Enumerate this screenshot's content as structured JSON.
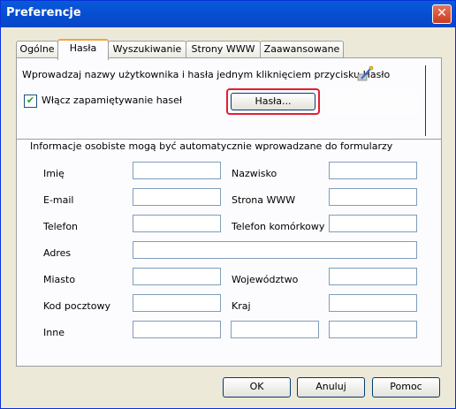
{
  "window": {
    "title": "Preferencje"
  },
  "tabs": [
    {
      "label": "Ogólne"
    },
    {
      "label": "Hasła"
    },
    {
      "label": "Wyszukiwanie"
    },
    {
      "label": "Strony WWW"
    },
    {
      "label": "Zaawansowane"
    }
  ],
  "passwords": {
    "info": "Wprowadzaj nazwy użytkownika i hasła jednym kliknięciem przycisku Hasło",
    "checkbox_label": "Włącz zapamiętywanie haseł",
    "checkbox_checked": true,
    "button_label": "Hasła..."
  },
  "personal": {
    "info": "Informacje osobiste mogą być automatycznie wprowadzane do formularzy",
    "fields": {
      "first_name": {
        "label": "Imię",
        "value": ""
      },
      "last_name": {
        "label": "Nazwisko",
        "value": ""
      },
      "email": {
        "label": "E-mail",
        "value": ""
      },
      "website": {
        "label": "Strona WWW",
        "value": ""
      },
      "phone": {
        "label": "Telefon",
        "value": ""
      },
      "mobile": {
        "label": "Telefon komórkowy",
        "value": ""
      },
      "address": {
        "label": "Adres",
        "value": ""
      },
      "city": {
        "label": "Miasto",
        "value": ""
      },
      "province": {
        "label": "Województwo",
        "value": ""
      },
      "postal": {
        "label": "Kod pocztowy",
        "value": ""
      },
      "country": {
        "label": "Kraj",
        "value": ""
      },
      "other": {
        "label": "Inne",
        "value": ""
      }
    }
  },
  "footer": {
    "ok": "OK",
    "cancel": "Anuluj",
    "help": "Pomoc"
  }
}
